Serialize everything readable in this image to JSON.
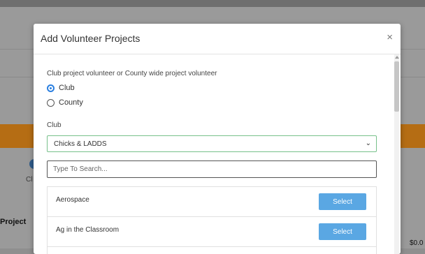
{
  "background": {
    "fragment_left": "Cl",
    "project_label": "Project",
    "money": "$0.0"
  },
  "modal": {
    "title": "Add Volunteer Projects",
    "close_label": "×",
    "question": "Club project volunteer or County wide project volunteer",
    "options": [
      {
        "label": "Club",
        "checked": true
      },
      {
        "label": "County",
        "checked": false
      }
    ],
    "club_label": "Club",
    "club_selected": "Chicks & LADDS",
    "search": {
      "placeholder": "Type To Search...",
      "value": ""
    },
    "projects": [
      {
        "name": "Aerospace",
        "button": "Select"
      },
      {
        "name": "Ag in the Classroom",
        "button": "Select"
      }
    ]
  },
  "colors": {
    "accent": "#2a7fe0",
    "button": "#5aa7e3",
    "select_border": "#77c08a"
  }
}
